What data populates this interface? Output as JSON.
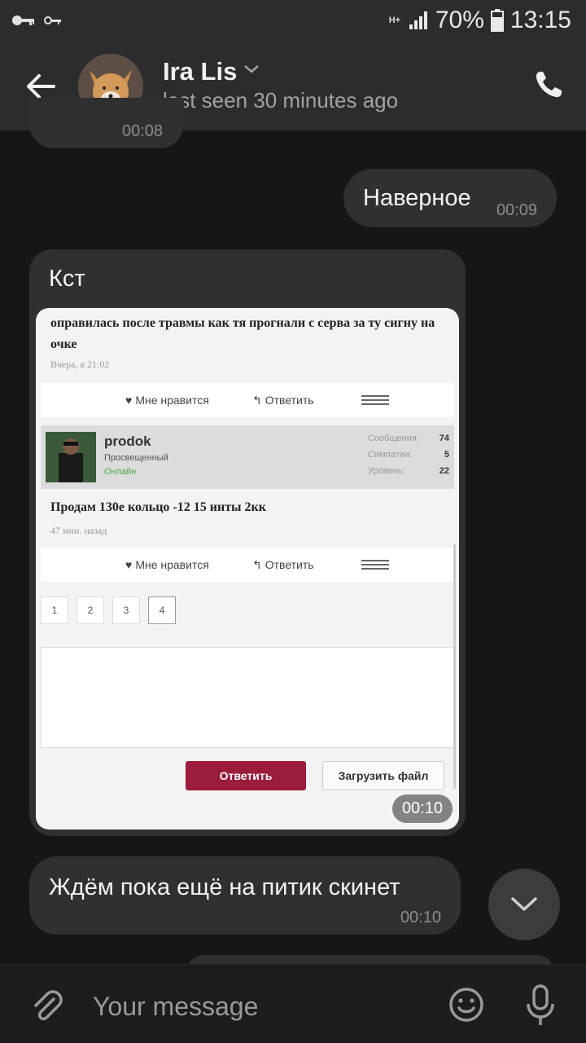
{
  "status_bar": {
    "network": "H+",
    "battery": "70%",
    "time": "13:15"
  },
  "header": {
    "contact_name": "Ira Lis",
    "last_seen": "last seen 30 minutes ago"
  },
  "messages": [
    {
      "type": "text",
      "direction": "in",
      "text": "",
      "time": "00:08"
    },
    {
      "type": "text",
      "direction": "out",
      "text": "Наверное",
      "time": "00:09"
    },
    {
      "type": "image",
      "direction": "in",
      "caption": "Кст",
      "time": "00:10"
    },
    {
      "type": "text",
      "direction": "in",
      "text": "Ждём пока ещё на питик скинет",
      "time": "00:10"
    }
  ],
  "forum_screenshot": {
    "post1_text": "оправилась после травмы как тя прогнали с серва за ту сигну на очке",
    "post1_date": "Вчера, в 21:02",
    "like_label": "Мне нравится",
    "reply_label": "Ответить",
    "user": {
      "name": "prodok",
      "rank": "Просвещенный",
      "status": "Онлайн",
      "stats": [
        {
          "label": "Сообщения:",
          "value": "74"
        },
        {
          "label": "Симпатии:",
          "value": "5"
        },
        {
          "label": "Уровень:",
          "value": "22"
        }
      ]
    },
    "post2_text": "Продам 130е кольцо -12 15 инты 2кк",
    "post2_date": "47 мин. назад",
    "pages": [
      "1",
      "2",
      "3",
      "4"
    ],
    "current_page": "4",
    "reply_button": "Ответить",
    "upload_button": "Загрузить файл"
  },
  "input": {
    "placeholder": "Your message"
  },
  "colors": {
    "background": "#161616",
    "header": "#2b2c2e",
    "bubble": "#2f3032",
    "forum_button": "#9b1c3c"
  },
  "icons": [
    "key-icon",
    "key-small-icon",
    "signal-icon",
    "battery-icon",
    "back-arrow-icon",
    "chevron-down-icon",
    "phone-icon",
    "scroll-down-icon",
    "paperclip-icon",
    "emoji-icon",
    "mic-icon"
  ]
}
